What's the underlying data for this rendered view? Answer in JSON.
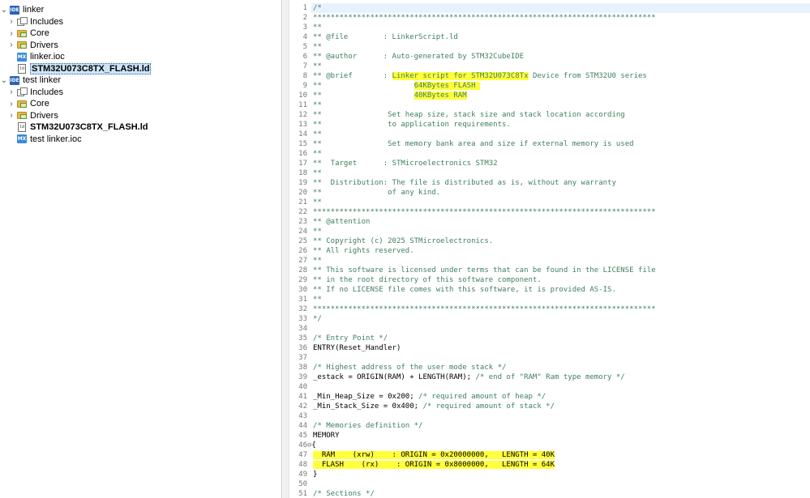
{
  "explorer": {
    "items": [
      {
        "label": "linker",
        "icon": "ide-project-icon",
        "indent": 0,
        "chev": "⌄",
        "bold": false,
        "selected": false
      },
      {
        "label": "Includes",
        "icon": "includes-icon",
        "indent": 1,
        "chev": "›",
        "bold": false,
        "selected": false
      },
      {
        "label": "Core",
        "icon": "folder-icon",
        "indent": 1,
        "chev": "›",
        "bold": false,
        "selected": false
      },
      {
        "label": "Drivers",
        "icon": "folder-icon",
        "indent": 1,
        "chev": "›",
        "bold": false,
        "selected": false
      },
      {
        "label": "linker.ioc",
        "icon": "mx-file-icon",
        "indent": 1,
        "chev": "",
        "bold": false,
        "selected": false
      },
      {
        "label": "STM32U073C8TX_FLASH.ld",
        "icon": "ld-file-icon",
        "indent": 1,
        "chev": "",
        "bold": true,
        "selected": true
      },
      {
        "label": "test linker",
        "icon": "ide-project-icon",
        "indent": 0,
        "chev": "⌄",
        "bold": false,
        "selected": false
      },
      {
        "label": "Includes",
        "icon": "includes-icon",
        "indent": 1,
        "chev": "›",
        "bold": false,
        "selected": false
      },
      {
        "label": "Core",
        "icon": "folder-icon",
        "indent": 1,
        "chev": "›",
        "bold": false,
        "selected": false
      },
      {
        "label": "Drivers",
        "icon": "folder-icon",
        "indent": 1,
        "chev": "›",
        "bold": false,
        "selected": false
      },
      {
        "label": "STM32U073C8TX_FLASH.ld",
        "icon": "ld-file-icon",
        "indent": 1,
        "chev": "",
        "bold": true,
        "selected": false
      },
      {
        "label": "test linker.ioc",
        "icon": "mx-file-icon",
        "indent": 1,
        "chev": "",
        "bold": false,
        "selected": false
      }
    ]
  },
  "editor": {
    "lines": [
      {
        "n": "1",
        "t": "/*"
      },
      {
        "n": "2",
        "t": "******************************************************************************"
      },
      {
        "n": "3",
        "t": "**"
      },
      {
        "n": "4",
        "t": "** @file        : LinkerScript.ld"
      },
      {
        "n": "5",
        "t": "**"
      },
      {
        "n": "6",
        "t": "** @author      : Auto-generated by STM32CubeIDE"
      },
      {
        "n": "7",
        "t": "**"
      },
      {
        "n": "8",
        "t": "** @brief       : ",
        "h": "Linker script for STM32U073C8Tx",
        "a": " Device from STM32U0 series"
      },
      {
        "n": "9",
        "t": "**                     ",
        "h": "64KBytes FLASH "
      },
      {
        "n": "10",
        "t": "**                     ",
        "h": "40KBytes RAM"
      },
      {
        "n": "11",
        "t": "**"
      },
      {
        "n": "12",
        "t": "**               Set heap size, stack size and stack location according"
      },
      {
        "n": "13",
        "t": "**               to application requirements."
      },
      {
        "n": "14",
        "t": "**"
      },
      {
        "n": "15",
        "t": "**               Set memory bank area and size if external memory is used"
      },
      {
        "n": "16",
        "t": "**"
      },
      {
        "n": "17",
        "t": "**  Target      : STMicroelectronics STM32"
      },
      {
        "n": "18",
        "t": "**"
      },
      {
        "n": "19",
        "t": "**  Distribution: The file is distributed as is, without any warranty"
      },
      {
        "n": "20",
        "t": "**               of any kind."
      },
      {
        "n": "21",
        "t": "**"
      },
      {
        "n": "22",
        "t": "******************************************************************************"
      },
      {
        "n": "23",
        "t": "** @attention"
      },
      {
        "n": "24",
        "t": "**"
      },
      {
        "n": "25",
        "t": "** Copyright (c) 2025 STMicroelectronics."
      },
      {
        "n": "26",
        "t": "** All rights reserved."
      },
      {
        "n": "27",
        "t": "**"
      },
      {
        "n": "28",
        "t": "** This software is licensed under terms that can be found in the LICENSE file"
      },
      {
        "n": "29",
        "t": "** in the root directory of this software component."
      },
      {
        "n": "30",
        "t": "** If no LICENSE file comes with this software, it is provided AS-IS."
      },
      {
        "n": "31",
        "t": "**"
      },
      {
        "n": "32",
        "t": "******************************************************************************"
      },
      {
        "n": "33",
        "t": "*/"
      },
      {
        "n": "34",
        "t": ""
      },
      {
        "n": "35",
        "t": "/* Entry Point */"
      },
      {
        "n": "36",
        "t": "ENTRY(Reset_Handler)",
        "plain": true
      },
      {
        "n": "37",
        "t": ""
      },
      {
        "n": "38",
        "t": "/* Highest address of the user mode stack */"
      },
      {
        "n": "39",
        "t": "_estack = ORIGIN(RAM) + LENGTH(RAM); ",
        "plain": true,
        "c": "/* end of \"RAM\" Ram type memory */"
      },
      {
        "n": "40",
        "t": ""
      },
      {
        "n": "41",
        "t": "_Min_Heap_Size = 0x200; ",
        "plain": true,
        "c": "/* required amount of heap */"
      },
      {
        "n": "42",
        "t": "_Min_Stack_Size = 0x400; ",
        "plain": true,
        "c": "/* required amount of stack */"
      },
      {
        "n": "43",
        "t": ""
      },
      {
        "n": "44",
        "t": "/* Memories definition */"
      },
      {
        "n": "45",
        "t": "MEMORY",
        "plain": true
      },
      {
        "n": "46",
        "fold": "⊖",
        "t": "{",
        "plain": true
      },
      {
        "n": "47",
        "t": "",
        "plain": true,
        "h": "  RAM    (xrw)    : ORIGIN = 0x20000000,   LENGTH = 40K"
      },
      {
        "n": "48",
        "t": "",
        "plain": true,
        "h": "  FLASH    (rx)    : ORIGIN = 0x8000000,   LENGTH = 64K"
      },
      {
        "n": "49",
        "t": "}",
        "plain": true
      },
      {
        "n": "50",
        "t": ""
      },
      {
        "n": "51",
        "t": "/* Sections */"
      }
    ]
  }
}
